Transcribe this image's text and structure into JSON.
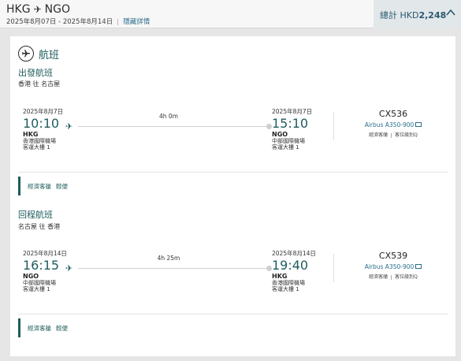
{
  "header": {
    "origin": "HKG",
    "destination": "NGO",
    "date_range": "2025年8月07日 - 2025年8月14日",
    "hide_details": "隱藏詳情",
    "total_label": "總計 HKD",
    "total_amount": "2,248"
  },
  "section": {
    "title": "航班"
  },
  "outbound": {
    "title": "出發航班",
    "route": "香港 往 名古屋",
    "dep_date": "2025年8月7日",
    "dep_time": "10:10",
    "dep_code": "HKG",
    "dep_airport": "香港國際機場",
    "dep_terminal": "客運大樓 1",
    "duration": "4h 0m",
    "arr_date": "2025年8月7日",
    "arr_time": "15:10",
    "arr_code": "NGO",
    "arr_airport": "中部國際機場",
    "arr_terminal": "客運大樓 1",
    "flight_number": "CX536",
    "aircraft": "Airbus A350-900",
    "cabin_tag": "經濟客艙",
    "class_tag": "客位級別Q",
    "fare_cabin": "經濟客艙",
    "fare_type": "輕便"
  },
  "inbound": {
    "title": "回程航班",
    "route": "名古屋 往 香港",
    "dep_date": "2025年8月14日",
    "dep_time": "16:15",
    "dep_code": "NGO",
    "dep_airport": "中部國際機場",
    "dep_terminal": "客運大樓 1",
    "duration": "4h 25m",
    "arr_date": "2025年8月14日",
    "arr_time": "19:40",
    "arr_code": "HKG",
    "arr_airport": "香港國際機場",
    "arr_terminal": "客運大樓 1",
    "flight_number": "CX539",
    "aircraft": "Airbus A350-900",
    "cabin_tag": "經濟客艙",
    "class_tag": "客位級別Q",
    "fare_cabin": "經濟客艙",
    "fare_type": "輕便"
  },
  "colors": {
    "accent": "#1f5c5e",
    "link": "#2a6e8c",
    "total_bg": "#e2e7ea"
  },
  "icons": {
    "route": "plane-icon",
    "section": "plane-circle-icon",
    "collapse": "chevron-up-icon",
    "aircraft": "screen-icon"
  }
}
